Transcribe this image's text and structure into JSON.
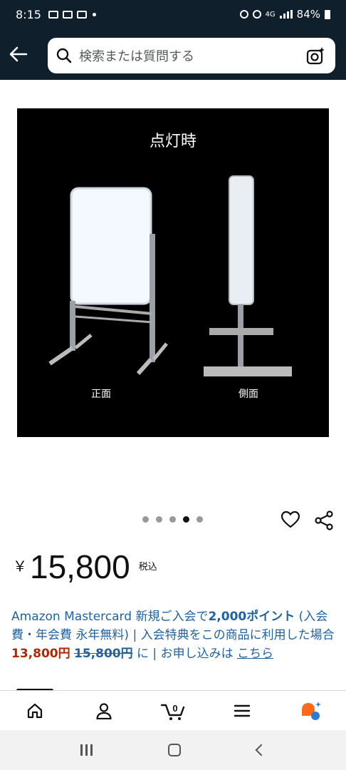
{
  "status_bar": {
    "time": "8:15",
    "battery": "84%",
    "network": "4G"
  },
  "search": {
    "placeholder": "検索または質問する"
  },
  "product_image": {
    "caption": "点灯時",
    "label_front": "正面",
    "label_side": "側面"
  },
  "carousel": {
    "count": 5,
    "active_index": 3
  },
  "price": {
    "currency": "￥",
    "amount": "15,800",
    "tax_label": "税込"
  },
  "promo": {
    "part1": "Amazon Mastercard 新規ご入会で",
    "points": "2,000ポイント",
    "part2": "(入会費・年会費 永年無料) | 入会特典をこの商品に利用した場合",
    "discount_price": "13,800円",
    "original_price": "15,800円",
    "part3": "に | お申し込みは",
    "link": "こちら"
  },
  "bottom_nav": {
    "items": [
      "home-icon",
      "account-icon",
      "cart-icon",
      "menu-icon",
      "ai-assistant-icon"
    ],
    "cart_count": "0"
  },
  "colors": {
    "header_bg": "#0f1f2c",
    "link": "#2162a1",
    "price_red": "#b12704"
  }
}
